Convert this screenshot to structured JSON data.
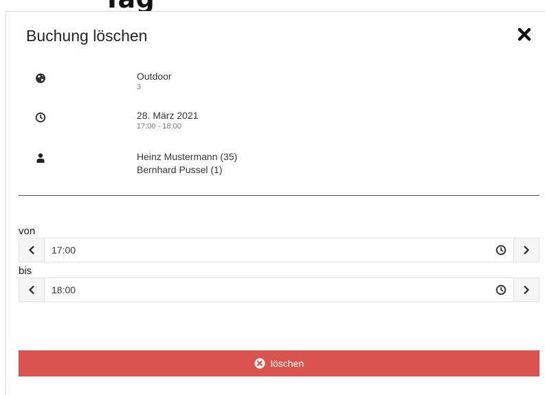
{
  "background_title": "Tag",
  "modal": {
    "title": "Buchung löschen",
    "close_icon": "times-icon",
    "location": {
      "name": "Outdoor",
      "detail": "3",
      "icon": "globe-icon"
    },
    "datetime": {
      "date": "28. März 2021",
      "time_range": "17:00 - 18:00",
      "icon": "clock-icon"
    },
    "persons": {
      "icon": "user-icon",
      "names": [
        "Heinz Mustermann (35)",
        "Bernhard Pussel (1)"
      ]
    },
    "from_field": {
      "label": "von",
      "value": "17:00"
    },
    "to_field": {
      "label": "bis",
      "value": "18:00"
    },
    "delete_button": {
      "label": "löschen",
      "icon": "times-circle-icon",
      "color": "#d9534f"
    }
  }
}
